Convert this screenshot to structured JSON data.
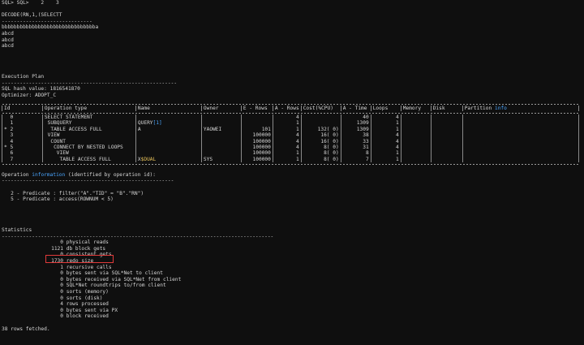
{
  "header": {
    "prompt": "SQL> SQL>    2    3",
    "query_snippet": "DECODE(RN,1,(SELECTT",
    "divider": "------------------------------",
    "result_lines": [
      "bbbbbbbbbbbbbbbbbbbbbbbbbbbbbbba",
      "abcd",
      "abcd",
      "abcd"
    ]
  },
  "plan": {
    "title": "Execution Plan",
    "divider": "----------------------------------------------------------",
    "hash": "SQL hash value: 1816541870",
    "optimizer": "Optimizer: ADOPT_C",
    "columns": [
      "Id",
      "Operation type",
      "Name",
      "Owner",
      "E - Rows",
      "A - Rows",
      "Cost(%CPU)",
      "A - Time",
      "Loops",
      "Memory",
      "Disk",
      "Partition info"
    ],
    "rows": [
      {
        "id": "  0 ",
        "op": "SELECT STATEMENT",
        "name": "",
        "owner": "",
        "erows": "",
        "arows": "4",
        "cost": "",
        "atime": "40",
        "loops": "4",
        "memory": "",
        "disk": "",
        "part": ""
      },
      {
        "id": "  1 ",
        "op": " SUBQUERY",
        "name": "QUERY[1]",
        "owner": "",
        "erows": "",
        "arows": "1",
        "cost": "",
        "atime": "1309",
        "loops": "1",
        "memory": "",
        "disk": "",
        "part": ""
      },
      {
        "id": "* 2 ",
        "op": "  TABLE ACCESS FULL",
        "name": "A",
        "owner": "YAOWEI",
        "erows": "101",
        "arows": "1",
        "cost": "132( 0)",
        "atime": "1309",
        "loops": "1",
        "memory": "",
        "disk": "",
        "part": ""
      },
      {
        "id": "  3 ",
        "op": " VIEW",
        "name": "",
        "owner": "",
        "erows": "100000",
        "arows": "4",
        "cost": "16( 0)",
        "atime": "38",
        "loops": "4",
        "memory": "",
        "disk": "",
        "part": ""
      },
      {
        "id": "  4 ",
        "op": "  COUNT",
        "name": "",
        "owner": "",
        "erows": "100000",
        "arows": "4",
        "cost": "16( 0)",
        "atime": "33",
        "loops": "4",
        "memory": "",
        "disk": "",
        "part": ""
      },
      {
        "id": "* 5 ",
        "op": "   CONNECT BY NESTED LOOPS",
        "name": "",
        "owner": "",
        "erows": "100000",
        "arows": "4",
        "cost": "8( 0)",
        "atime": "31",
        "loops": "4",
        "memory": "",
        "disk": "",
        "part": ""
      },
      {
        "id": "  6 ",
        "op": "    VIEW",
        "name": "",
        "owner": "",
        "erows": "100000",
        "arows": "1",
        "cost": "8( 0)",
        "atime": "8",
        "loops": "1",
        "memory": "",
        "disk": "",
        "part": ""
      },
      {
        "id": "  7 ",
        "op": "     TABLE ACCESS FULL",
        "name": "X$DUAL",
        "owner": "SYS",
        "erows": "100000",
        "arows": "1",
        "cost": "8( 0)",
        "atime": "7",
        "loops": "1",
        "memory": "",
        "disk": "",
        "part": ""
      }
    ]
  },
  "operation_info": {
    "title_pre": "Operation ",
    "title_hl": "information",
    "title_post": " (identified by operation id):",
    "divider": "---------------------------------------------------------",
    "lines": [
      "   2 - Predicate : filter(\"A\".\"TID\" = \"B\".\"RN\")",
      "   5 - Predicate : access(ROWNUM < 5)"
    ]
  },
  "statistics": {
    "title": "Statistics",
    "divider": "------------------------------------------------------------------------------------------",
    "rows": [
      {
        "value": "0",
        "label": "physical reads"
      },
      {
        "value": "1121",
        "label": "db block gets"
      },
      {
        "value": "0",
        "label": "consistent gets"
      },
      {
        "value": "1730",
        "label": "redo size"
      },
      {
        "value": "1",
        "label": "recursive calls"
      },
      {
        "value": "0",
        "label": "bytes sent via SQL*Net to client"
      },
      {
        "value": "0",
        "label": "bytes received via SQL*Net from client"
      },
      {
        "value": "0",
        "label": "SQL*Net roundtrips to/from client"
      },
      {
        "value": "0",
        "label": "sorts (memory)"
      },
      {
        "value": "0",
        "label": "sorts (disk)"
      },
      {
        "value": "4",
        "label": "rows processed"
      },
      {
        "value": "0",
        "label": "bytes sent via PX"
      },
      {
        "value": "0",
        "label": "block received"
      }
    ]
  },
  "footer": "38 rows fetched.",
  "colors": {
    "background": "#0f0f0f",
    "text": "#d6d6d6",
    "highlight_blue": "#4aa6ff",
    "highlight_yellow": "#e6c15a",
    "annotation_red": "#e03a3a"
  }
}
